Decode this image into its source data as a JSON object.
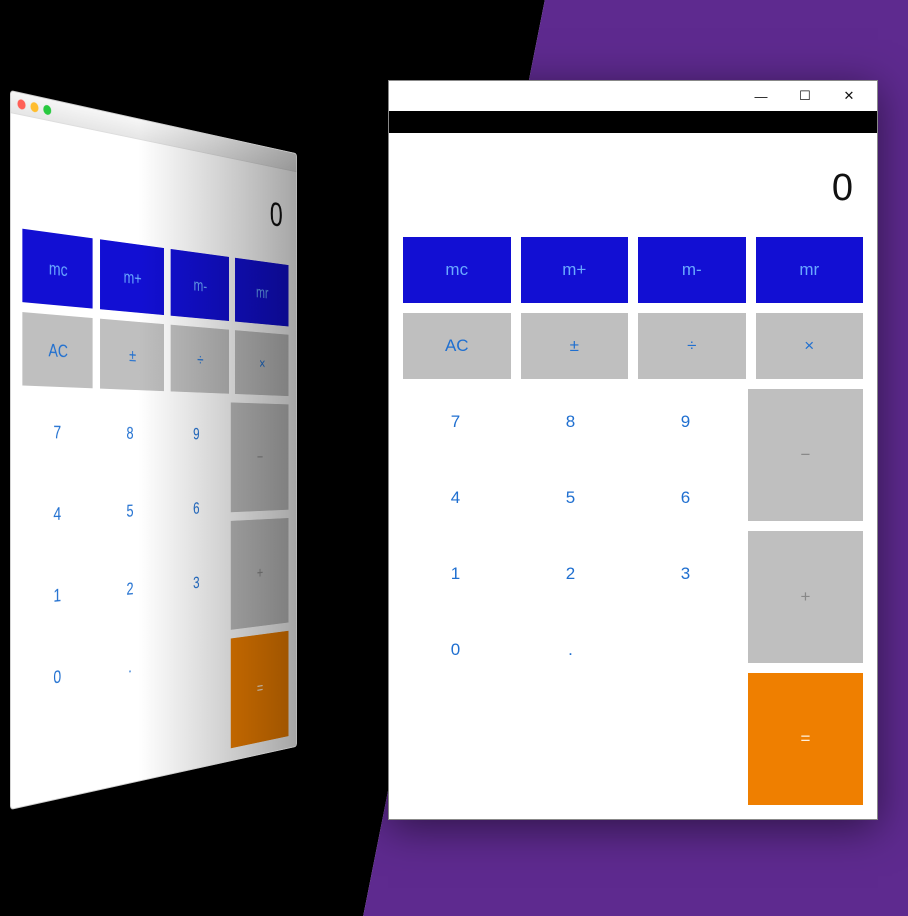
{
  "colors": {
    "purple": "#5e2a8f",
    "mem_blue": "#120fd3",
    "accent_blue": "#1f6fd0",
    "gray": "#bfbfbf",
    "orange": "#ef7f00"
  },
  "mac": {
    "display": "0",
    "mem": {
      "mc": "mc",
      "mplus": "m+",
      "mminus": "m-",
      "mr": "mr"
    },
    "func": {
      "ac": "AC",
      "sign": "±",
      "div": "÷",
      "mul": "×"
    },
    "digits": {
      "d7": "7",
      "d8": "8",
      "d9": "9",
      "d4": "4",
      "d5": "5",
      "d6": "6",
      "d1": "1",
      "d2": "2",
      "d3": "3",
      "d0": "0",
      "dot": "."
    },
    "ops": {
      "minus": "−",
      "plus": "+",
      "eq": "="
    }
  },
  "win": {
    "controls": {
      "minimize": "—",
      "maximize": "☐",
      "close": "✕"
    },
    "display": "0",
    "mem": {
      "mc": "mc",
      "mplus": "m+",
      "mminus": "m-",
      "mr": "mr"
    },
    "func": {
      "ac": "AC",
      "sign": "±",
      "div": "÷",
      "mul": "×"
    },
    "digits": {
      "d7": "7",
      "d8": "8",
      "d9": "9",
      "d4": "4",
      "d5": "5",
      "d6": "6",
      "d1": "1",
      "d2": "2",
      "d3": "3",
      "d0": "0",
      "dot": "."
    },
    "ops": {
      "minus": "−",
      "plus": "+",
      "eq": "="
    }
  }
}
